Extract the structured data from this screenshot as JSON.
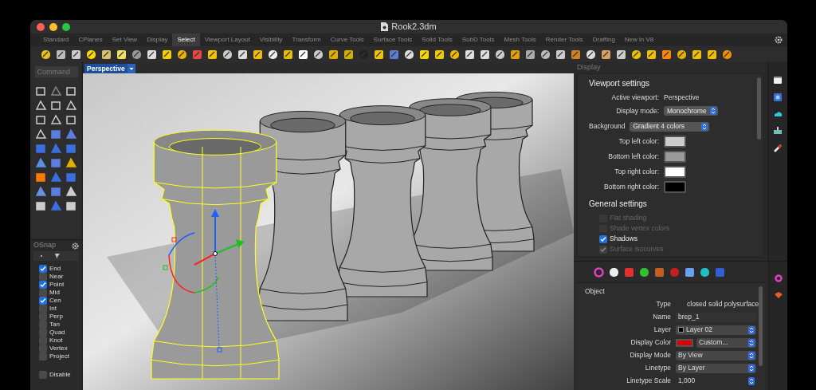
{
  "window": {
    "title": "Rook2.3dm"
  },
  "tabs": [
    {
      "label": "Standard",
      "selected": false
    },
    {
      "label": "CPlanes",
      "selected": false
    },
    {
      "label": "Set View",
      "selected": false
    },
    {
      "label": "Display",
      "selected": false
    },
    {
      "label": "Select",
      "selected": true
    },
    {
      "label": "Viewport Layout",
      "selected": false
    },
    {
      "label": "Visibility",
      "selected": false
    },
    {
      "label": "Transform",
      "selected": false
    },
    {
      "label": "Curve Tools",
      "selected": false
    },
    {
      "label": "Surface Tools",
      "selected": false
    },
    {
      "label": "Solid Tools",
      "selected": false
    },
    {
      "label": "SubD Tools",
      "selected": false
    },
    {
      "label": "Mesh Tools",
      "selected": false
    },
    {
      "label": "Render Tools",
      "selected": false
    },
    {
      "label": "Drafting",
      "selected": false
    },
    {
      "label": "New in V8",
      "selected": false
    }
  ],
  "command": {
    "placeholder": "Command"
  },
  "osnap": {
    "title": "OSnap",
    "items": [
      {
        "label": "End",
        "checked": true
      },
      {
        "label": "Near",
        "checked": false
      },
      {
        "label": "Point",
        "checked": true
      },
      {
        "label": "Mid",
        "checked": false
      },
      {
        "label": "Cen",
        "checked": true
      },
      {
        "label": "Int",
        "checked": false
      },
      {
        "label": "Perp",
        "checked": false
      },
      {
        "label": "Tan",
        "checked": false
      },
      {
        "label": "Quad",
        "checked": false
      },
      {
        "label": "Knot",
        "checked": false
      },
      {
        "label": "Vertex",
        "checked": false
      },
      {
        "label": "Project",
        "checked": false
      }
    ],
    "disable": {
      "label": "Disable",
      "checked": false
    }
  },
  "viewport": {
    "title": "Perspective"
  },
  "display_panel": {
    "title": "Display",
    "section_1": "Viewport settings",
    "rows": [
      {
        "kind": "text",
        "label": "Active viewport:",
        "value": "Perspective"
      },
      {
        "kind": "select",
        "label": "Display mode:",
        "value": "Monochrome"
      },
      {
        "kind": "wide-select",
        "label": "Background",
        "value": "Gradient 4 colors"
      },
      {
        "kind": "color",
        "label": "Top left color:",
        "color": "#cccccc"
      },
      {
        "kind": "color",
        "label": "Bottom left color:",
        "color": "#9a9a9a"
      },
      {
        "kind": "color",
        "label": "Top right color:",
        "color": "#ffffff"
      },
      {
        "kind": "color",
        "label": "Bottom right color:",
        "color": "#000000"
      }
    ],
    "section_2": "General settings",
    "options": [
      {
        "label": "Flat shading",
        "checked": false,
        "disabled": true
      },
      {
        "label": "Shade vertex colors",
        "checked": false,
        "disabled": true
      },
      {
        "label": "Shadows",
        "checked": true,
        "disabled": false
      },
      {
        "label": "Surface isocurves",
        "checked": true,
        "disabled": true
      }
    ]
  },
  "properties_panel": {
    "section": "Object",
    "rows": [
      {
        "kind": "text",
        "label": "Type",
        "value": "closed solid polysurface"
      },
      {
        "kind": "field",
        "label": "Name",
        "value": "brep_1"
      },
      {
        "kind": "select",
        "label": "Layer",
        "value": "Layer 02",
        "color": "#000000"
      },
      {
        "kind": "color-select",
        "label": "Display Color",
        "value": "Custom...",
        "color": "#e00000"
      },
      {
        "kind": "select",
        "label": "Display Mode",
        "value": "By View"
      },
      {
        "kind": "select",
        "label": "Linetype",
        "value": "By Layer"
      },
      {
        "kind": "spinner",
        "label": "Linetype Scale",
        "value": "1,000"
      }
    ]
  }
}
